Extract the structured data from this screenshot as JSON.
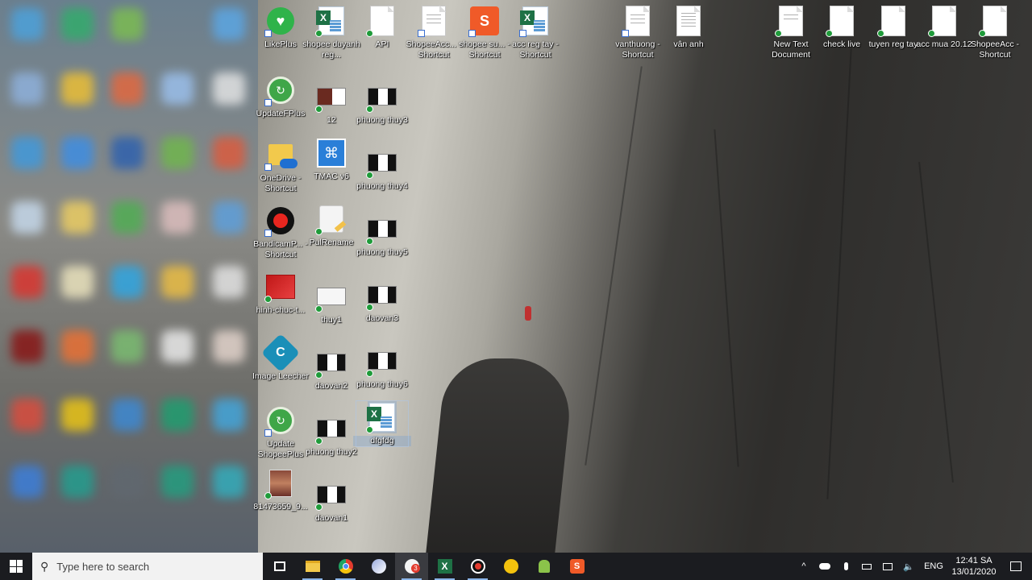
{
  "desktop": {
    "icons": [
      {
        "label": "LikePlus"
      },
      {
        "label": "UpdateFPlus"
      },
      {
        "label": "OneDrive - Shortcut"
      },
      {
        "label": "BandicamP... - Shortcut"
      },
      {
        "label": "hinh-chuc-t..."
      },
      {
        "label": "Image Leecher"
      },
      {
        "label": "Update ShopeePlus"
      },
      {
        "label": "81473659_9..."
      },
      {
        "label": "shopee duyanh reg..."
      },
      {
        "label": "12"
      },
      {
        "label": "TMAC v6"
      },
      {
        "label": "PulRename"
      },
      {
        "label": "thuy1"
      },
      {
        "label": "daovan2"
      },
      {
        "label": "phuong thuy2"
      },
      {
        "label": "daovan1"
      },
      {
        "label": "API"
      },
      {
        "label": "phuong thuy3"
      },
      {
        "label": "phuong thuy4"
      },
      {
        "label": "phuong thuy5"
      },
      {
        "label": "daovan3"
      },
      {
        "label": "phuong thuy6"
      },
      {
        "label": "dfgfdg"
      },
      {
        "label": "ShopeeAcc... - Shortcut"
      },
      {
        "label": "shopee su... - Shortcut"
      },
      {
        "label": "acc reg tay - Shortcut"
      },
      {
        "label": "vanthuong - Shortcut"
      },
      {
        "label": "vân anh"
      },
      {
        "label": "New Text Document"
      },
      {
        "label": "check live"
      },
      {
        "label": "tuyen reg tay"
      },
      {
        "label": "acc mua 20.12"
      },
      {
        "label": "ShopeeAcc - Shortcut"
      }
    ]
  },
  "taskbar": {
    "search_placeholder": "Type here to search",
    "chrome_badge": "3",
    "tray": {
      "language": "ENG",
      "time": "12:41 SA",
      "date": "13/01/2020"
    }
  },
  "colors": {
    "taskbar_bg": "#1b1c20",
    "accent": "#8ab4e8",
    "excel_green": "#1e7145"
  }
}
